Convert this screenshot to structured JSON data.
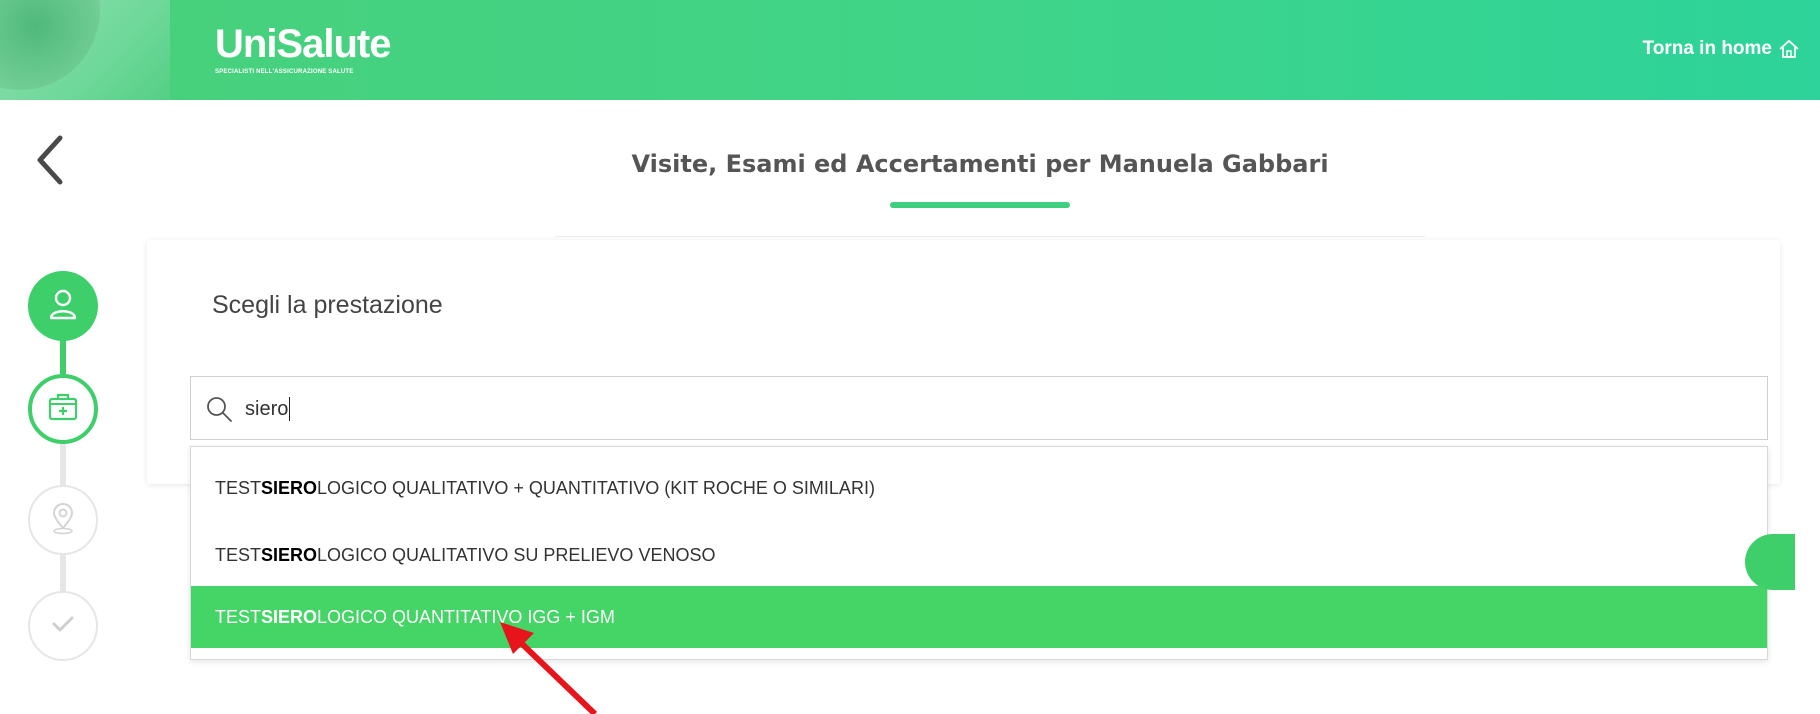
{
  "header": {
    "logo_text": "UniSalute",
    "logo_tagline": "SPECIALISTI NELL'ASSICURAZIONE SALUTE",
    "home_link_label": "Torna in home",
    "home_icon": "home-icon"
  },
  "page": {
    "title": "Visite, Esami ed Accertamenti per Manuela Gabbari",
    "back_icon": "chevron-left-icon"
  },
  "stepper": {
    "steps": [
      {
        "icon": "user-icon",
        "state": "completed"
      },
      {
        "icon": "medical-kit-icon",
        "state": "active"
      },
      {
        "icon": "location-pin-icon",
        "state": "pending"
      },
      {
        "icon": "check-icon",
        "state": "pending"
      }
    ]
  },
  "card": {
    "title": "Scegli la prestazione",
    "search": {
      "value": "siero",
      "icon": "search-icon"
    }
  },
  "dropdown": {
    "options": [
      {
        "prefix": "TEST ",
        "match": "SIERO",
        "suffix": "LOGICO QUALITATIVO + QUANTITATIVO (KIT ROCHE O SIMILARI)",
        "selected": false
      },
      {
        "prefix": "TEST ",
        "match": "SIERO",
        "suffix": "LOGICO QUALITATIVO SU PRELIEVO VENOSO",
        "selected": false
      },
      {
        "prefix": "TEST ",
        "match": "SIERO",
        "suffix": "LOGICO QUANTITATIVO IGG + IGM",
        "selected": true
      }
    ]
  },
  "colors": {
    "brand_green": "#3fcf6a",
    "highlight_green": "#45d466",
    "annotation_red": "#e8141b"
  }
}
